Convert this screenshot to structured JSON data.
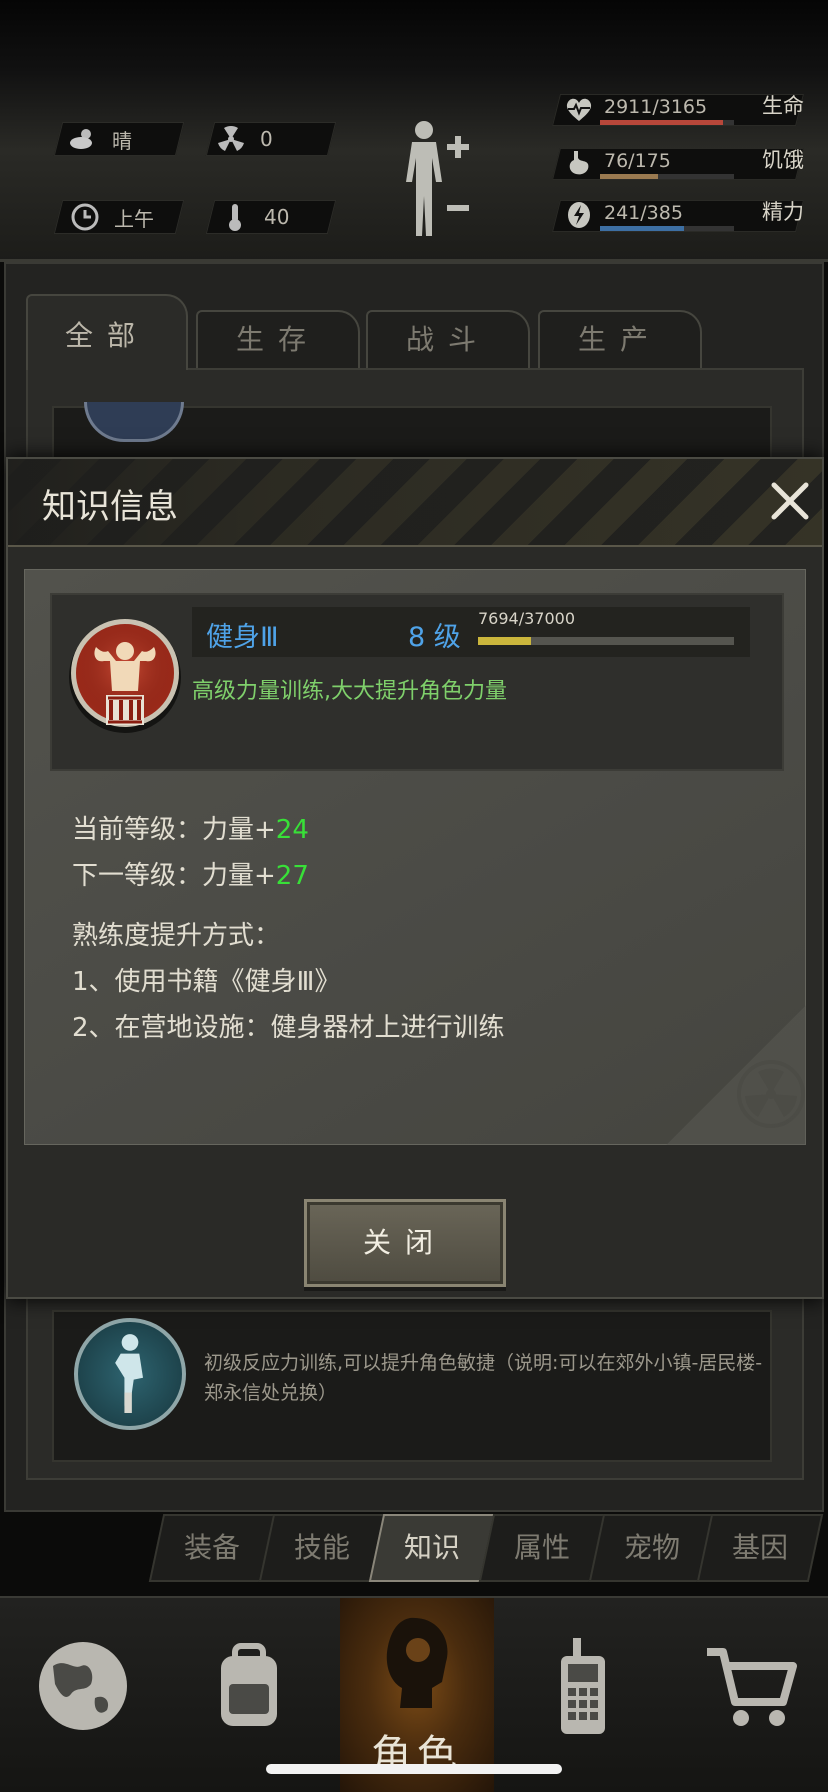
{
  "status": {
    "weather": "晴",
    "radiation": "0",
    "time_of_day": "上午",
    "temperature": "40"
  },
  "stats": [
    {
      "value": "2911/3165",
      "label": "生命",
      "icon": "heart-pulse-icon",
      "fill": 0.92,
      "color": "#b8473a"
    },
    {
      "value": "76/175",
      "label": "饥饿",
      "icon": "stomach-icon",
      "fill": 0.43,
      "color": "#9a7a50"
    },
    {
      "value": "241/385",
      "label": "精力",
      "icon": "energy-bolt-icon",
      "fill": 0.63,
      "color": "#3d6fa3"
    }
  ],
  "tabs": [
    "全部",
    "生存",
    "战斗",
    "生产"
  ],
  "background_item": {
    "description": "初级反应力训练,可以提升角色敏捷（说明:可以在郊外小镇-居民楼-郑永信处兑换）"
  },
  "sub_tabs": [
    "装备",
    "技能",
    "知识",
    "属性",
    "宠物",
    "基因"
  ],
  "bottom_nav": {
    "active_label": "角色"
  },
  "dialog": {
    "title": "知识信息",
    "skill_name": "健身Ⅲ",
    "skill_level": "8 级",
    "xp_text": "7694/37000",
    "xp_fraction": 0.208,
    "skill_desc": "高级力量训练,大大提升角色力量",
    "current_prefix": "当前等级：力量+",
    "current_value": "24",
    "next_prefix": "下一等级：力量+",
    "next_value": "27",
    "method_title": "熟练度提升方式：",
    "method_1": "1、使用书籍《健身Ⅲ》",
    "method_2": "2、在营地设施：健身器材上进行训练",
    "close_label": "关闭"
  }
}
